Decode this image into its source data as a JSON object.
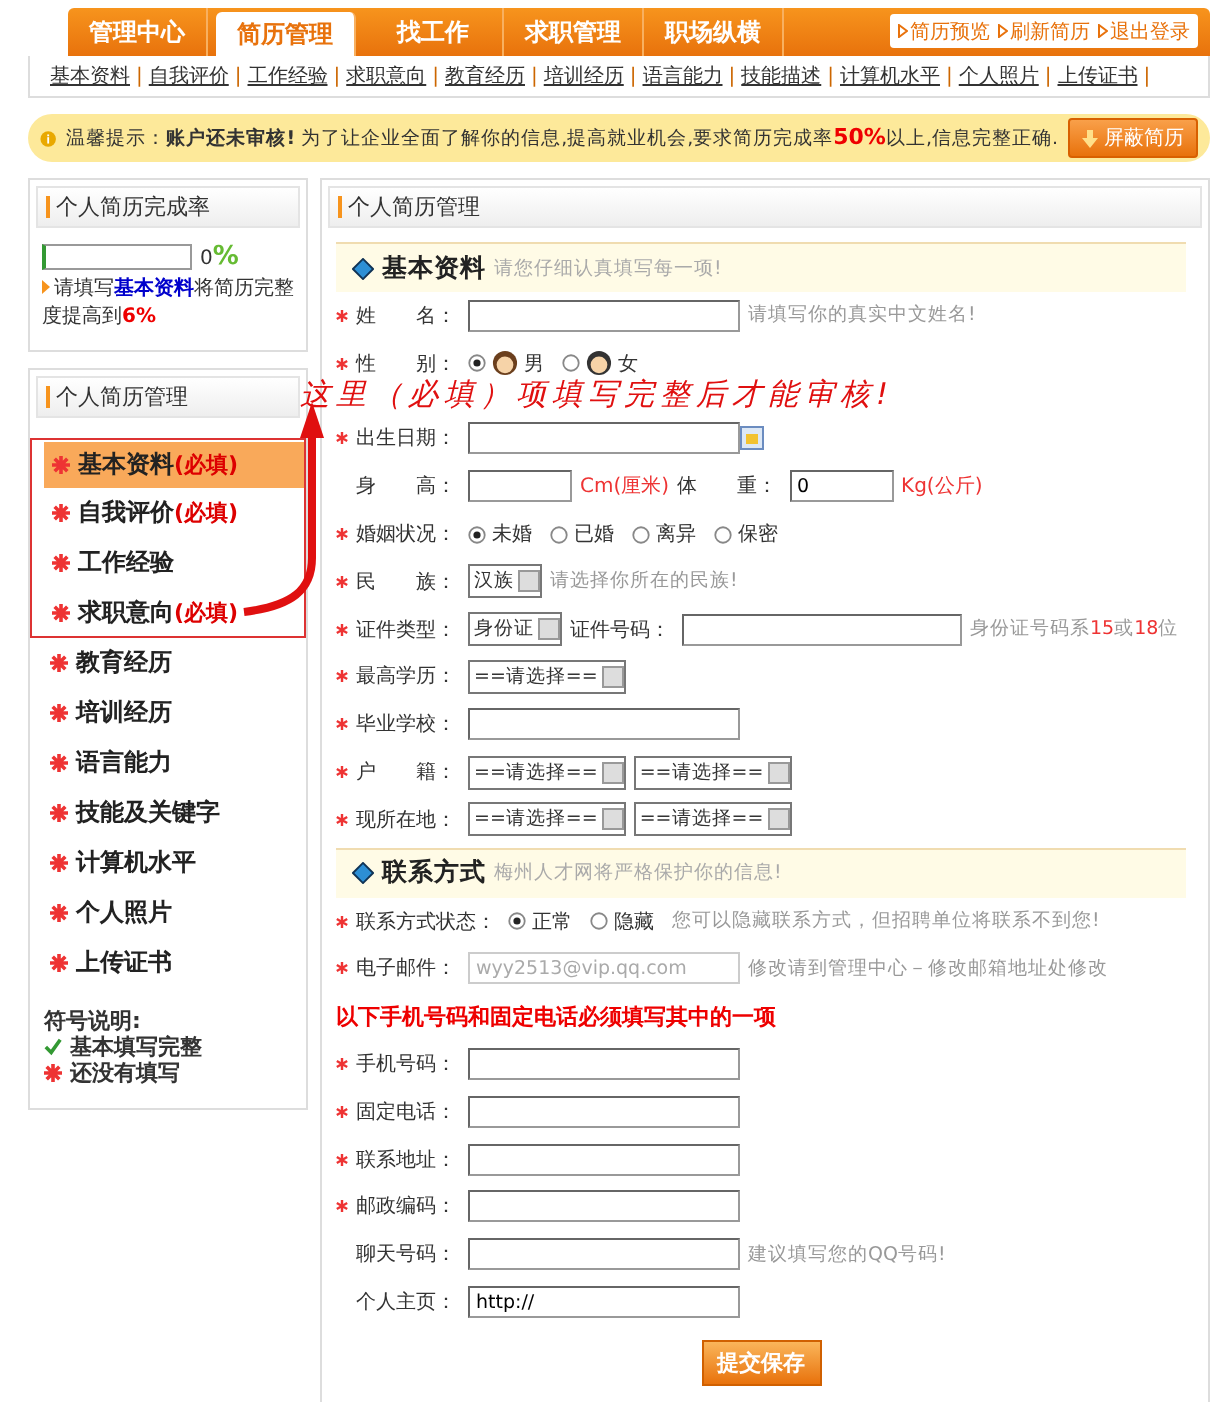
{
  "nav": {
    "tabs": [
      {
        "label": "管理中心",
        "selected": false
      },
      {
        "label": "简历管理",
        "selected": true
      },
      {
        "label": "找工作",
        "selected": false
      },
      {
        "label": "求职管理",
        "selected": false
      },
      {
        "label": "职场纵横",
        "selected": false
      }
    ],
    "links": [
      "简历预览",
      "刷新简历",
      "退出登录"
    ]
  },
  "subnav": [
    {
      "label": "基本资料",
      "separator": "|"
    },
    {
      "label": "自我评价",
      "separator": "|"
    },
    {
      "label": "工作经验",
      "separator": "|"
    },
    {
      "label": "求职意向",
      "separator": "|"
    },
    {
      "label": "教育经历",
      "separator": "|"
    },
    {
      "label": "培训经历",
      "separator": "|"
    },
    {
      "label": "语言能力",
      "separator": "|"
    },
    {
      "label": "技能描述",
      "separator": "|"
    },
    {
      "label": "计算机水平",
      "separator": "|"
    },
    {
      "label": "个人照片",
      "separator": "|"
    },
    {
      "label": "上传证书",
      "separator": "|"
    }
  ],
  "notice": {
    "label": "温馨提示：",
    "strong": "账户还未审核!",
    "text": "为了让企业全面了解你的信息,提高就业机会,要求简历完成率**50%**以上,信息完整正确.",
    "button": "屏蔽简历"
  },
  "completion": {
    "title": "个人简历完成率",
    "level": 0,
    "reading": "0",
    "unit": "%",
    "hint": [
      {
        "kind": "plain",
        "text": "请填写"
      },
      {
        "kind": "link",
        "text": "基本资料"
      },
      {
        "kind": "plain",
        "text": "将简历完整度提高到"
      },
      {
        "kind": "emph",
        "text": "6%"
      }
    ]
  },
  "menu": {
    "title": "个人简历管理",
    "items": [
      {
        "label": "基本资料",
        "required": "(必填)",
        "selected": true,
        "highlighted": true
      },
      {
        "label": "自我评价",
        "required": "(必填)",
        "selected": false,
        "highlighted": true
      },
      {
        "label": "工作经验",
        "selected": false,
        "highlighted": true
      },
      {
        "label": "求职意向",
        "required": "(必填)",
        "selected": false,
        "highlighted": true
      },
      {
        "label": "教育经历",
        "selected": false,
        "highlighted": false
      },
      {
        "label": "培训经历",
        "selected": false,
        "highlighted": false
      },
      {
        "label": "语言能力",
        "selected": false,
        "highlighted": false
      },
      {
        "label": "技能及关键字",
        "selected": false,
        "highlighted": false
      },
      {
        "label": "计算机水平",
        "selected": false,
        "highlighted": false
      },
      {
        "label": "个人照片",
        "selected": false,
        "highlighted": false
      },
      {
        "label": "上传证书",
        "selected": false,
        "highlighted": false
      }
    ],
    "legend": {
      "title": "符号说明:",
      "items": [
        {
          "kind": "done",
          "label": "基本填写完整"
        },
        {
          "kind": "todo",
          "label": "还没有填写"
        }
      ]
    }
  },
  "form": {
    "title": "个人简历管理",
    "sections": [
      {
        "title": "基本资料",
        "hint": "请您仔细认真填写每一项!",
        "rows": [
          {
            "kind": "text",
            "label": "姓　　名：",
            "required": true,
            "hint": "请填写你的真实中文姓名!"
          },
          {
            "kind": "gender",
            "label": "性　　别：",
            "required": true,
            "options": [
              {
                "label": "男",
                "selected": true
              },
              {
                "label": "女",
                "selected": false
              }
            ]
          },
          {
            "kind": "date",
            "label": "出生日期：",
            "required": true
          },
          {
            "kind": "measure",
            "label": "身　　高：",
            "required": false,
            "unit": "Cm(厘米)",
            "label2": "体　　重：",
            "value2": "0",
            "unit2": "Kg(公斤)"
          },
          {
            "kind": "radio",
            "label": "婚姻状况：",
            "required": true,
            "options": [
              {
                "label": "未婚",
                "selected": true
              },
              {
                "label": "已婚",
                "selected": false
              },
              {
                "label": "离异",
                "selected": false
              },
              {
                "label": "保密",
                "selected": false
              }
            ]
          },
          {
            "kind": "select",
            "label": "民　　族：",
            "required": true,
            "selects": [
              "汉族"
            ],
            "hint": "请选择你所在的民族!"
          },
          {
            "kind": "id",
            "label": "证件类型：",
            "required": true,
            "selects": [
              "身份证"
            ],
            "label2": "证件号码：",
            "hint": "身份证号码系**15**或**18**位"
          },
          {
            "kind": "select",
            "label": "最高学历：",
            "required": true,
            "selects": [
              "==请选择=="
            ]
          },
          {
            "kind": "text",
            "label": "毕业学校：",
            "required": true
          },
          {
            "kind": "select",
            "label": "户　　籍：",
            "required": true,
            "selects": [
              "==请选择==",
              "==请选择=="
            ]
          },
          {
            "kind": "select",
            "label": "现所在地：",
            "required": true,
            "selects": [
              "==请选择==",
              "==请选择=="
            ]
          }
        ]
      },
      {
        "title": "联系方式",
        "hint": "梅州人才网将严格保护你的信息!",
        "rows": [
          {
            "kind": "radio",
            "label": "联系方式状态：",
            "required": true,
            "options": [
              {
                "label": "正常",
                "selected": true
              },
              {
                "label": "隐藏",
                "selected": false
              }
            ],
            "hint": "您可以隐藏联系方式，但招聘单位将联系不到您!"
          },
          {
            "kind": "text",
            "label": "电子邮件：",
            "required": true,
            "value": "wyy2513@vip.qq.com",
            "disabled": true,
            "hint": "修改请到管理中心－修改邮箱地址处修改"
          },
          {
            "kind": "note",
            "text": "以下手机号码和固定电话必须填写其中的一项"
          },
          {
            "kind": "text",
            "label": "手机号码：",
            "required": true
          },
          {
            "kind": "text",
            "label": "固定电话：",
            "required": true
          },
          {
            "kind": "text",
            "label": "联系地址：",
            "required": true
          },
          {
            "kind": "text",
            "label": "邮政编码：",
            "required": true
          },
          {
            "kind": "text",
            "label": "聊天号码：",
            "required": false,
            "hint": "建议填写您的QQ号码!"
          },
          {
            "kind": "text",
            "label": "个人主页：",
            "required": false,
            "value": "http://"
          }
        ]
      }
    ],
    "submit": "提交保存"
  },
  "annotation": {
    "text": "这里（必填）项填写完整后才能审核!"
  }
}
